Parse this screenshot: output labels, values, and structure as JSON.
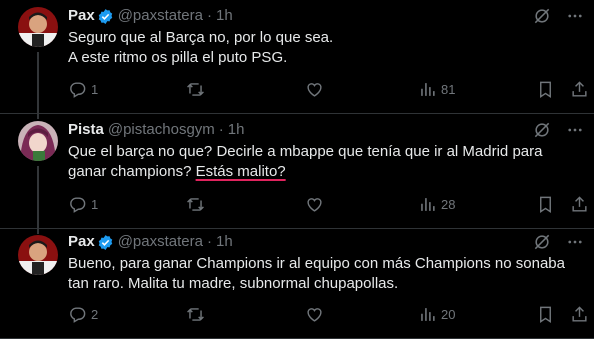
{
  "tweets": [
    {
      "display_name": "Pax",
      "handle": "@paxstatera",
      "time": "1h",
      "verified": true,
      "lines": [
        "Seguro que al Barça no, por lo que sea.",
        "A este ritmo os pilla el puto PSG."
      ],
      "replies": "1",
      "retweets": "",
      "likes": "",
      "views": "81",
      "avatar": "avatar-pax",
      "thread": true
    },
    {
      "display_name": "Pista",
      "handle": "@pistachosgym",
      "time": "1h",
      "verified": false,
      "line1": "Que el barça no que? Decirle a mbappe que tenía que ir al Madrid para",
      "line2_start": "ganar champions? ",
      "line2_underlined": "Estás malito?",
      "replies": "1",
      "retweets": "",
      "likes": "",
      "views": "28",
      "avatar": "avatar-pista",
      "thread": true
    },
    {
      "display_name": "Pax",
      "handle": "@paxstatera",
      "time": "1h",
      "verified": true,
      "lines": [
        "Bueno, para ganar Champions ir al equipo con más Champions no sonaba",
        "tan raro. Malita tu madre, subnormal chupapollas."
      ],
      "replies": "2",
      "retweets": "",
      "likes": "",
      "views": "20",
      "avatar": "avatar-pax",
      "thread": false
    }
  ],
  "dot": "·",
  "colors": {
    "background": "#000000",
    "text": "#e7e9ea",
    "muted": "#71767b",
    "verified": "#1d9bf0",
    "divider": "#2f3336",
    "underline": "#e0245e"
  },
  "icons": [
    "grok-icon",
    "more-icon",
    "reply-icon",
    "retweet-icon",
    "like-icon",
    "views-icon",
    "bookmark-icon",
    "share-icon",
    "verified-badge-icon"
  ]
}
